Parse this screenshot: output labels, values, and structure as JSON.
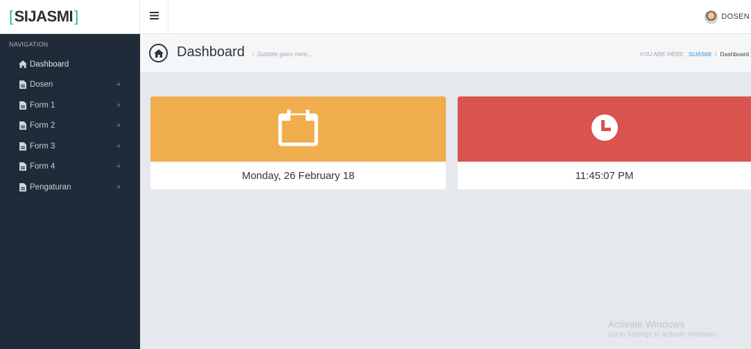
{
  "brand": {
    "open": "[",
    "name": "SIJASMI",
    "close": "]",
    "accent": "#1abc9c"
  },
  "sidebar": {
    "heading": "NAVIGATION",
    "items": [
      {
        "label": "Dashboard",
        "icon": "home-icon",
        "expandable": false
      },
      {
        "label": "Dosen",
        "icon": "document-icon",
        "expandable": true,
        "plus": "+"
      },
      {
        "label": "Form 1",
        "icon": "document-icon",
        "expandable": true,
        "plus": "+"
      },
      {
        "label": "Form 2",
        "icon": "document-icon",
        "expandable": true,
        "plus": "+"
      },
      {
        "label": "Form 3",
        "icon": "document-icon",
        "expandable": true,
        "plus": "+"
      },
      {
        "label": "Form 4",
        "icon": "document-icon",
        "expandable": true,
        "plus": "+"
      },
      {
        "label": "Pengaturan",
        "icon": "document-icon",
        "expandable": true,
        "plus": "+"
      }
    ]
  },
  "topbar": {
    "menu_icon": "hamburger-icon",
    "user_name": "DOSEN"
  },
  "header": {
    "title": "Dashboard",
    "subtitle_sep": "/",
    "subtitle": "Subtitle goes here...",
    "breadcrumb_prefix": "YOU ARE HERE:",
    "breadcrumb_link": "SIJASMI",
    "breadcrumb_sep": "/",
    "breadcrumb_current": "Dashboard"
  },
  "widgets": {
    "date": {
      "value": "Monday, 26 February 18",
      "color": "#f0ad4e",
      "icon": "calendar-icon"
    },
    "time": {
      "value": "11:45:07 PM",
      "color": "#d9534f",
      "icon": "clock-icon"
    }
  },
  "watermark": {
    "title": "Activate Windows",
    "subtitle": "Go to Settings to activate Windows."
  }
}
